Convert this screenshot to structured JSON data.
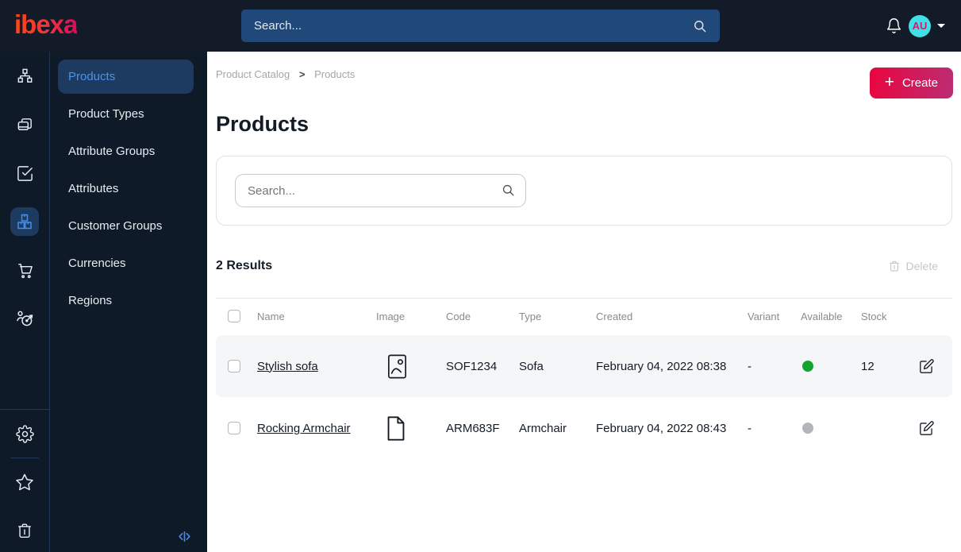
{
  "topbar": {
    "logo": "ibexa",
    "search_placeholder": "Search...",
    "avatar_initials": "AU"
  },
  "icon_rail": {
    "items": [
      "content-tree",
      "pages",
      "tasks",
      "product-catalog",
      "commerce",
      "personalization"
    ],
    "active_item": "product-catalog",
    "bottom_items": [
      "settings",
      "bookmarks",
      "trash"
    ]
  },
  "sidebar": {
    "items": [
      {
        "label": "Products",
        "active": true
      },
      {
        "label": "Product Types",
        "active": false
      },
      {
        "label": "Attribute Groups",
        "active": false
      },
      {
        "label": "Attributes",
        "active": false
      },
      {
        "label": "Customer Groups",
        "active": false
      },
      {
        "label": "Currencies",
        "active": false
      },
      {
        "label": "Regions",
        "active": false
      }
    ]
  },
  "breadcrumb": {
    "items": [
      "Product Catalog",
      "Products"
    ],
    "separator": ">"
  },
  "page": {
    "title": "Products",
    "create_button": "Create",
    "create_plus": "+"
  },
  "search_panel": {
    "placeholder": "Search..."
  },
  "results": {
    "count": "2 Results",
    "delete_button": "Delete"
  },
  "table": {
    "columns": [
      "Name",
      "Image",
      "Code",
      "Type",
      "Created",
      "Variant",
      "Available",
      "Stock"
    ],
    "rows": [
      {
        "name": "Stylish sofa",
        "image_icon": "image-icon",
        "code": "SOF1234",
        "type": "Sofa",
        "created": "February 04, 2022 08:38",
        "variant": "-",
        "available": "available",
        "stock": "12"
      },
      {
        "name": "Rocking Armchair",
        "image_icon": "file-icon",
        "code": "ARM683F",
        "type": "Armchair",
        "created": "February 04, 2022 08:43",
        "variant": "-",
        "available": "unavailable",
        "stock": ""
      }
    ]
  },
  "colors": {
    "topbar_bg": "#131b28",
    "sidebar_bg": "#0f1a28",
    "topbar_search_bg": "#20497a",
    "active_item_bg": "#1d3a61",
    "active_item_text": "#4b93e8",
    "brand_gradient_start": "#ff4713",
    "brand_gradient_end": "#db0a5b",
    "create_gradient_start": "#e8063f",
    "create_gradient_end": "#bc2c73",
    "avatar_bg": "#3fe1e6",
    "avatar_text": "#e0156e",
    "available_green": "#12a42e",
    "unavailable_grey": "#b2b5b9",
    "row_highlight": "#f5f6f8"
  }
}
